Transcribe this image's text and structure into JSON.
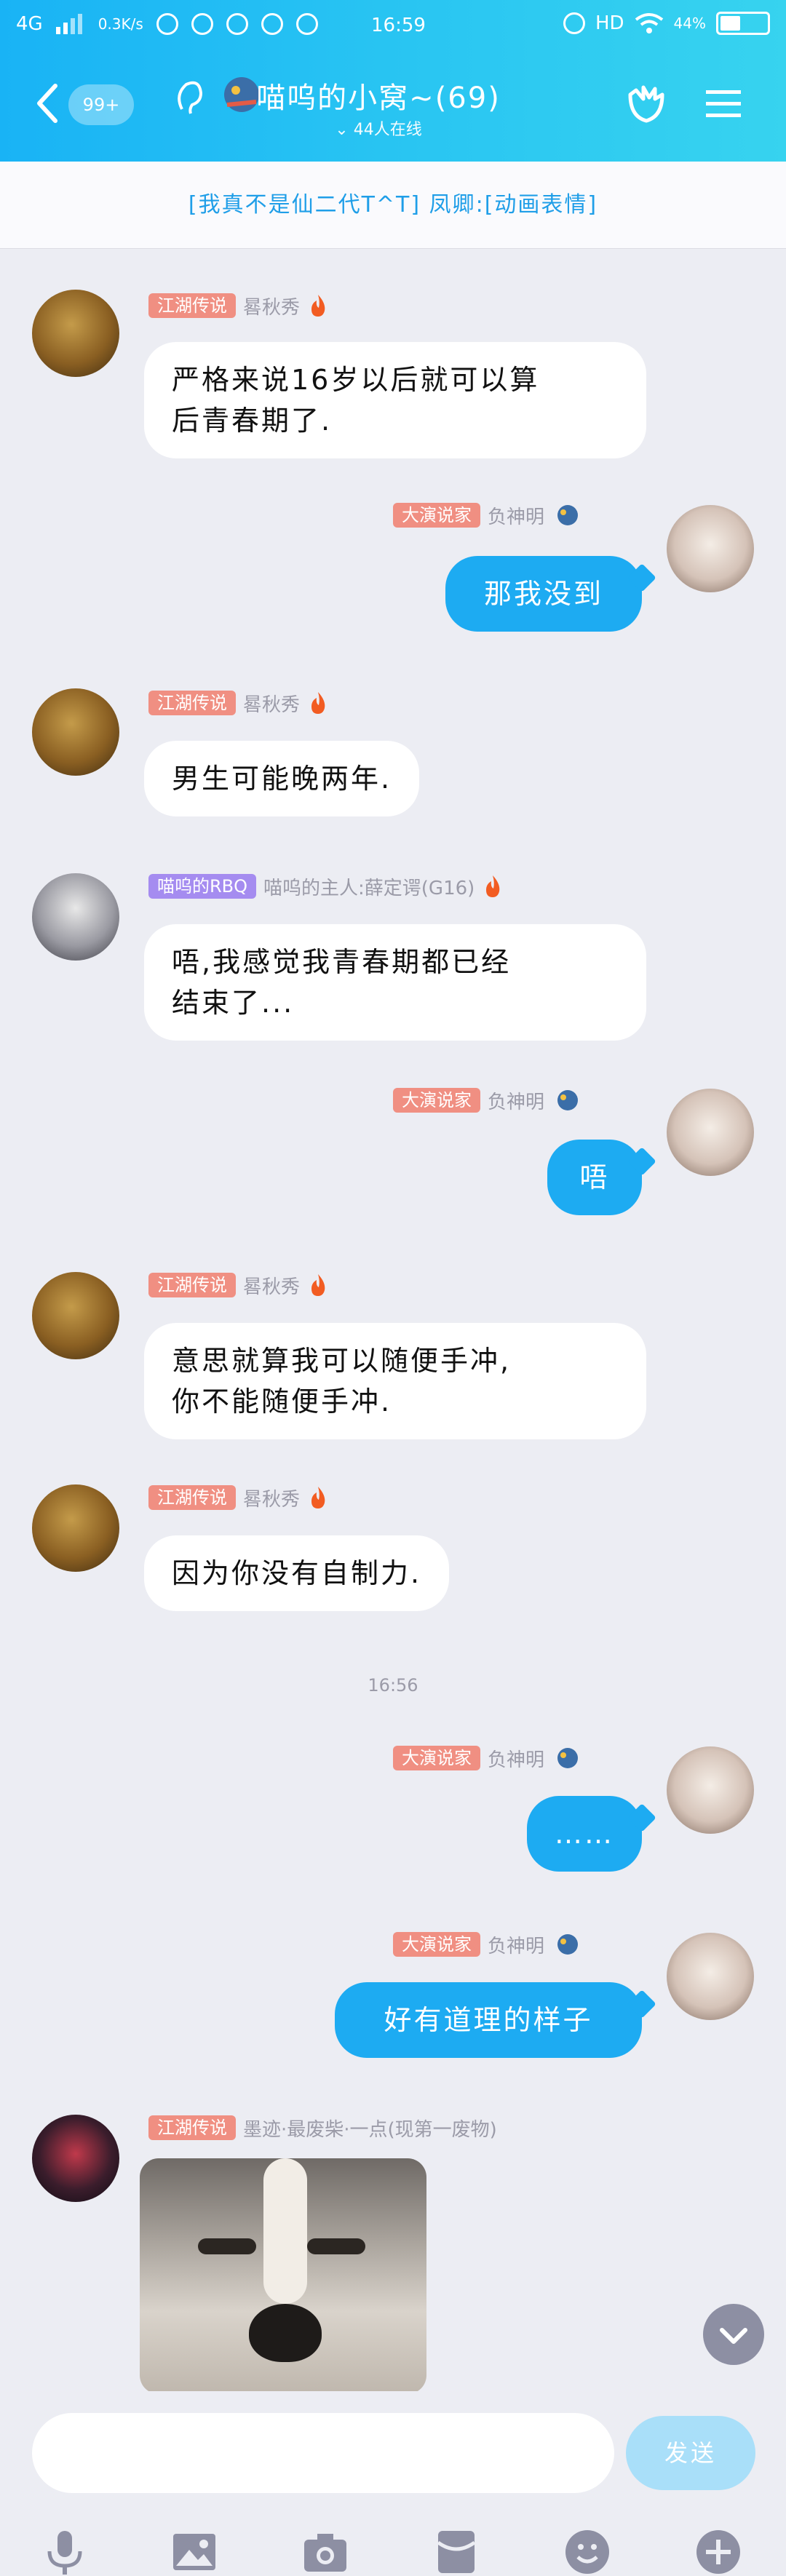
{
  "status": {
    "network": "4G",
    "speed": "0.3K/s",
    "time": "16:59",
    "hd": "HD",
    "battery": "44%",
    "battery_level": 0.44
  },
  "header": {
    "back_badge": "99+",
    "title": "喵呜的小窝~(69)",
    "online": "44人在线"
  },
  "notice": "[我真不是仙二代T^T] 凤卿:[动画表情]",
  "messages": [
    {
      "tag": "江湖传说",
      "name": "晷秋秀",
      "text_lines": [
        "严格来说16岁以后就可以算",
        "后青春期了."
      ]
    },
    {
      "tag": "大演说家",
      "name": "负神明",
      "text": "那我没到"
    },
    {
      "tag": "江湖传说",
      "name": "晷秋秀",
      "text": "男生可能晚两年."
    },
    {
      "tag": "喵呜的RBQ",
      "name": "喵呜的主人:薛定谔(G16)",
      "text_lines": [
        "唔,我感觉我青春期都已经",
        "结束了..."
      ]
    },
    {
      "tag": "大演说家",
      "name": "负神明",
      "text": "唔"
    },
    {
      "tag": "江湖传说",
      "name": "晷秋秀",
      "text_lines": [
        "意思就算我可以随便手冲,",
        "你不能随便手冲."
      ]
    },
    {
      "tag": "江湖传说",
      "name": "晷秋秀",
      "text": "因为你没有自制力."
    },
    {
      "time": "16:56"
    },
    {
      "tag": "大演说家",
      "name": "负神明",
      "text": "……"
    },
    {
      "tag": "大演说家",
      "name": "负神明",
      "text": "好有道理的样子"
    },
    {
      "tag": "江湖传说",
      "name": "墨迹·最废柴·一点(现第一废物)"
    }
  ],
  "input": {
    "placeholder": "",
    "send_label": "发送"
  },
  "colors": {
    "accent": "#1dabf2",
    "tag_red": "#f08f82",
    "tag_purple": "#a58cf0"
  },
  "icons": [
    "back-icon",
    "ear-icon",
    "dragon-icon",
    "group-icon",
    "menu-icon",
    "mic-icon",
    "image-icon",
    "camera-icon",
    "red-packet-icon",
    "emoji-icon",
    "plus-icon",
    "chevron-down-icon"
  ]
}
